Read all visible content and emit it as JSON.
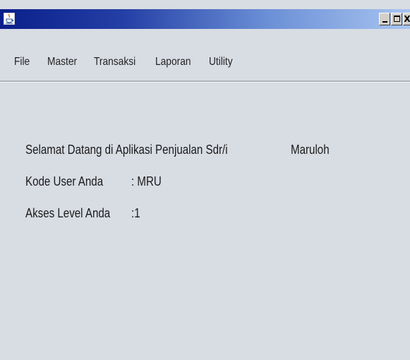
{
  "titlebar": {
    "title": "",
    "icon": "java-cup-icon",
    "minimize_label": "",
    "maximize_label": "",
    "close_label": "X"
  },
  "menu": {
    "items": [
      "File",
      "Master",
      "Transaksi",
      "Laporan",
      "Utility"
    ]
  },
  "welcome": {
    "greeting": "Selamat Datang di Aplikasi Penjualan Sdr/i",
    "user_name": "Maruloh",
    "user_code_label": "Kode User Anda",
    "user_code_value": ": MRU",
    "access_level_label": "Akses Level Anda",
    "access_level_value": ":1"
  },
  "colors": {
    "titlebar_start": "#0a1f8a",
    "titlebar_end": "#a8c4f0",
    "window_bg": "#d8dce3"
  }
}
